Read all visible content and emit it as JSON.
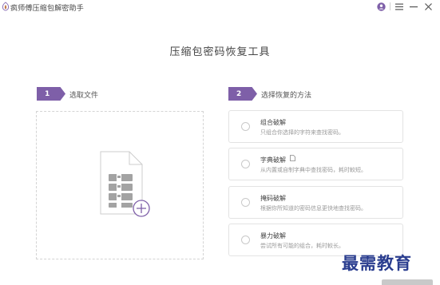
{
  "titlebar": {
    "app_name": "疯师傅压缩包解密助手",
    "icons": [
      "app-logo-icon",
      "account-icon",
      "menu-icon",
      "minimize-icon",
      "close-icon"
    ]
  },
  "main": {
    "title": "压缩包密码恢复工具",
    "step1": {
      "number": "1",
      "label": "选取文件",
      "dropzone_icon": "add-file-icon"
    },
    "step2": {
      "number": "2",
      "label": "选择恢复的方法",
      "methods": [
        {
          "title": "组合破解",
          "desc": "只组合你选择的字符来查找密码。"
        },
        {
          "title": "字典破解",
          "desc": "从内置或自制字典中查找密码，耗时較短。",
          "extra_icon": "dictionary-edit-icon"
        },
        {
          "title": "掩码破解",
          "desc": "根据你所知道的密码信息更快地查找密码。"
        },
        {
          "title": "暴力破解",
          "desc": "尝试所有可能的组合，耗时較长。"
        }
      ]
    }
  },
  "watermark": "最需教育",
  "colors": {
    "accent": "#7e5fa8",
    "watermark": "#2a3d8f",
    "border": "#e3e3e3"
  }
}
